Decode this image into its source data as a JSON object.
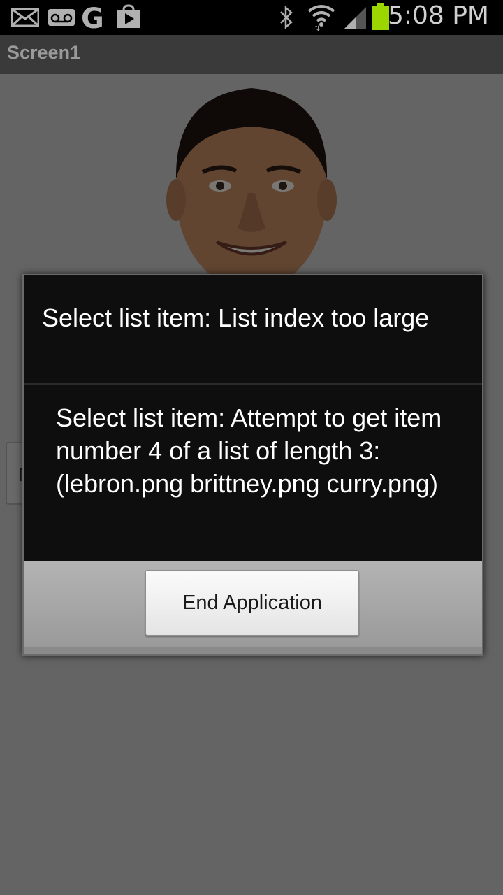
{
  "status_bar": {
    "time": "5:08 PM",
    "left_icons": [
      "mail-icon",
      "voicemail-icon",
      "google-icon",
      "play-store-icon"
    ],
    "right_icons": [
      "bluetooth-icon",
      "wifi-icon",
      "signal-icon",
      "battery-icon"
    ],
    "battery_color": "#9bd600"
  },
  "title_bar": {
    "title": "Screen1"
  },
  "content": {
    "next_button_label": "Next",
    "photo": "portrait-image"
  },
  "dialog": {
    "title": "Select list item: List index too large",
    "message": "Select list item: Attempt to get item number 4 of a list of length 3: (lebron.png brittney.png curry.png)",
    "button_label": "End Application"
  }
}
